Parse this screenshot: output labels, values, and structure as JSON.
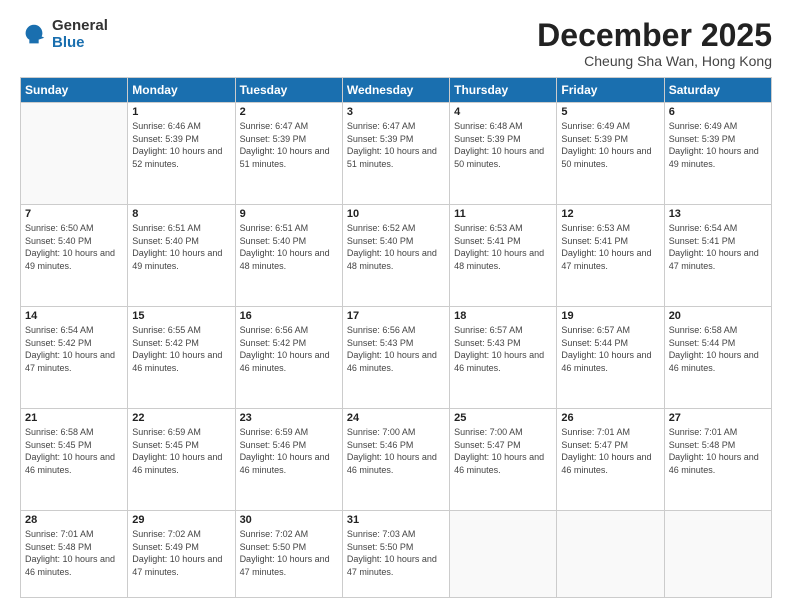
{
  "logo": {
    "general": "General",
    "blue": "Blue"
  },
  "header": {
    "month": "December 2025",
    "location": "Cheung Sha Wan, Hong Kong"
  },
  "weekdays": [
    "Sunday",
    "Monday",
    "Tuesday",
    "Wednesday",
    "Thursday",
    "Friday",
    "Saturday"
  ],
  "weeks": [
    [
      {
        "day": "",
        "sunrise": "",
        "sunset": "",
        "daylight": ""
      },
      {
        "day": "1",
        "sunrise": "Sunrise: 6:46 AM",
        "sunset": "Sunset: 5:39 PM",
        "daylight": "Daylight: 10 hours and 52 minutes."
      },
      {
        "day": "2",
        "sunrise": "Sunrise: 6:47 AM",
        "sunset": "Sunset: 5:39 PM",
        "daylight": "Daylight: 10 hours and 51 minutes."
      },
      {
        "day": "3",
        "sunrise": "Sunrise: 6:47 AM",
        "sunset": "Sunset: 5:39 PM",
        "daylight": "Daylight: 10 hours and 51 minutes."
      },
      {
        "day": "4",
        "sunrise": "Sunrise: 6:48 AM",
        "sunset": "Sunset: 5:39 PM",
        "daylight": "Daylight: 10 hours and 50 minutes."
      },
      {
        "day": "5",
        "sunrise": "Sunrise: 6:49 AM",
        "sunset": "Sunset: 5:39 PM",
        "daylight": "Daylight: 10 hours and 50 minutes."
      },
      {
        "day": "6",
        "sunrise": "Sunrise: 6:49 AM",
        "sunset": "Sunset: 5:39 PM",
        "daylight": "Daylight: 10 hours and 49 minutes."
      }
    ],
    [
      {
        "day": "7",
        "sunrise": "Sunrise: 6:50 AM",
        "sunset": "Sunset: 5:40 PM",
        "daylight": "Daylight: 10 hours and 49 minutes."
      },
      {
        "day": "8",
        "sunrise": "Sunrise: 6:51 AM",
        "sunset": "Sunset: 5:40 PM",
        "daylight": "Daylight: 10 hours and 49 minutes."
      },
      {
        "day": "9",
        "sunrise": "Sunrise: 6:51 AM",
        "sunset": "Sunset: 5:40 PM",
        "daylight": "Daylight: 10 hours and 48 minutes."
      },
      {
        "day": "10",
        "sunrise": "Sunrise: 6:52 AM",
        "sunset": "Sunset: 5:40 PM",
        "daylight": "Daylight: 10 hours and 48 minutes."
      },
      {
        "day": "11",
        "sunrise": "Sunrise: 6:53 AM",
        "sunset": "Sunset: 5:41 PM",
        "daylight": "Daylight: 10 hours and 48 minutes."
      },
      {
        "day": "12",
        "sunrise": "Sunrise: 6:53 AM",
        "sunset": "Sunset: 5:41 PM",
        "daylight": "Daylight: 10 hours and 47 minutes."
      },
      {
        "day": "13",
        "sunrise": "Sunrise: 6:54 AM",
        "sunset": "Sunset: 5:41 PM",
        "daylight": "Daylight: 10 hours and 47 minutes."
      }
    ],
    [
      {
        "day": "14",
        "sunrise": "Sunrise: 6:54 AM",
        "sunset": "Sunset: 5:42 PM",
        "daylight": "Daylight: 10 hours and 47 minutes."
      },
      {
        "day": "15",
        "sunrise": "Sunrise: 6:55 AM",
        "sunset": "Sunset: 5:42 PM",
        "daylight": "Daylight: 10 hours and 46 minutes."
      },
      {
        "day": "16",
        "sunrise": "Sunrise: 6:56 AM",
        "sunset": "Sunset: 5:42 PM",
        "daylight": "Daylight: 10 hours and 46 minutes."
      },
      {
        "day": "17",
        "sunrise": "Sunrise: 6:56 AM",
        "sunset": "Sunset: 5:43 PM",
        "daylight": "Daylight: 10 hours and 46 minutes."
      },
      {
        "day": "18",
        "sunrise": "Sunrise: 6:57 AM",
        "sunset": "Sunset: 5:43 PM",
        "daylight": "Daylight: 10 hours and 46 minutes."
      },
      {
        "day": "19",
        "sunrise": "Sunrise: 6:57 AM",
        "sunset": "Sunset: 5:44 PM",
        "daylight": "Daylight: 10 hours and 46 minutes."
      },
      {
        "day": "20",
        "sunrise": "Sunrise: 6:58 AM",
        "sunset": "Sunset: 5:44 PM",
        "daylight": "Daylight: 10 hours and 46 minutes."
      }
    ],
    [
      {
        "day": "21",
        "sunrise": "Sunrise: 6:58 AM",
        "sunset": "Sunset: 5:45 PM",
        "daylight": "Daylight: 10 hours and 46 minutes."
      },
      {
        "day": "22",
        "sunrise": "Sunrise: 6:59 AM",
        "sunset": "Sunset: 5:45 PM",
        "daylight": "Daylight: 10 hours and 46 minutes."
      },
      {
        "day": "23",
        "sunrise": "Sunrise: 6:59 AM",
        "sunset": "Sunset: 5:46 PM",
        "daylight": "Daylight: 10 hours and 46 minutes."
      },
      {
        "day": "24",
        "sunrise": "Sunrise: 7:00 AM",
        "sunset": "Sunset: 5:46 PM",
        "daylight": "Daylight: 10 hours and 46 minutes."
      },
      {
        "day": "25",
        "sunrise": "Sunrise: 7:00 AM",
        "sunset": "Sunset: 5:47 PM",
        "daylight": "Daylight: 10 hours and 46 minutes."
      },
      {
        "day": "26",
        "sunrise": "Sunrise: 7:01 AM",
        "sunset": "Sunset: 5:47 PM",
        "daylight": "Daylight: 10 hours and 46 minutes."
      },
      {
        "day": "27",
        "sunrise": "Sunrise: 7:01 AM",
        "sunset": "Sunset: 5:48 PM",
        "daylight": "Daylight: 10 hours and 46 minutes."
      }
    ],
    [
      {
        "day": "28",
        "sunrise": "Sunrise: 7:01 AM",
        "sunset": "Sunset: 5:48 PM",
        "daylight": "Daylight: 10 hours and 46 minutes."
      },
      {
        "day": "29",
        "sunrise": "Sunrise: 7:02 AM",
        "sunset": "Sunset: 5:49 PM",
        "daylight": "Daylight: 10 hours and 47 minutes."
      },
      {
        "day": "30",
        "sunrise": "Sunrise: 7:02 AM",
        "sunset": "Sunset: 5:50 PM",
        "daylight": "Daylight: 10 hours and 47 minutes."
      },
      {
        "day": "31",
        "sunrise": "Sunrise: 7:03 AM",
        "sunset": "Sunset: 5:50 PM",
        "daylight": "Daylight: 10 hours and 47 minutes."
      },
      {
        "day": "",
        "sunrise": "",
        "sunset": "",
        "daylight": ""
      },
      {
        "day": "",
        "sunrise": "",
        "sunset": "",
        "daylight": ""
      },
      {
        "day": "",
        "sunrise": "",
        "sunset": "",
        "daylight": ""
      }
    ]
  ]
}
